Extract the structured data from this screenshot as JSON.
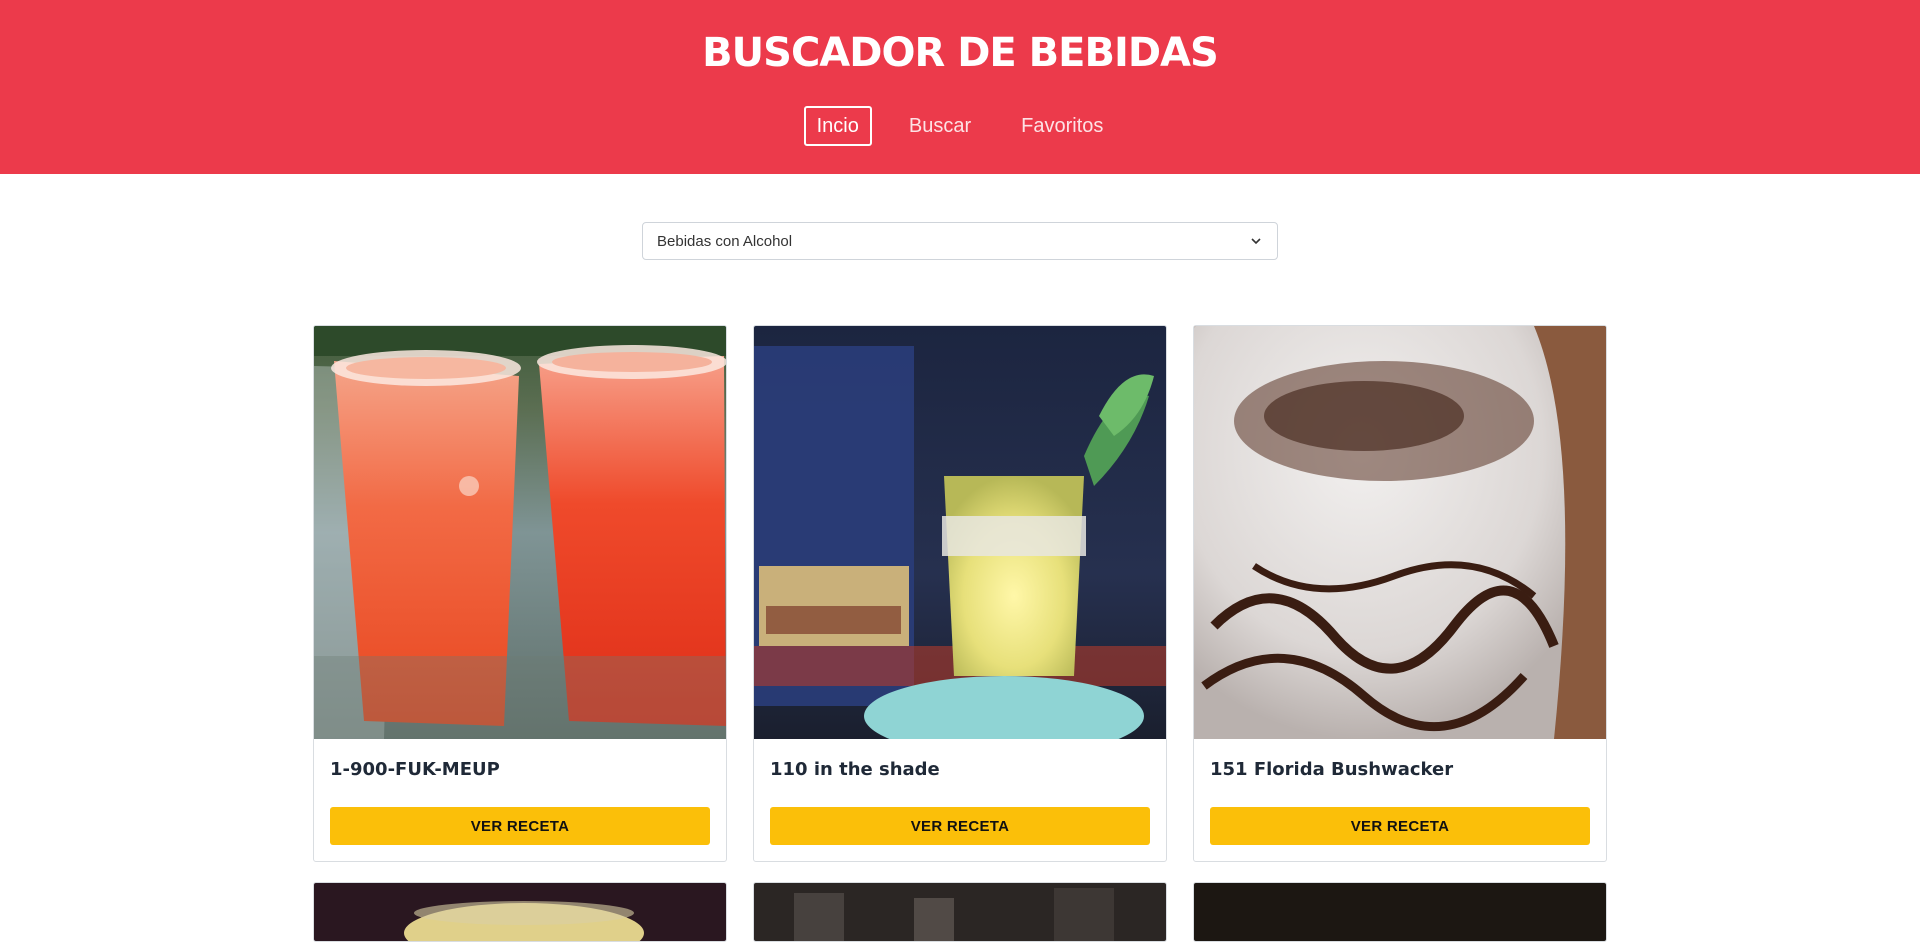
{
  "header": {
    "title": "BUSCADOR DE BEBIDAS",
    "nav": [
      {
        "label": "Incio",
        "active": true
      },
      {
        "label": "Buscar",
        "active": false
      },
      {
        "label": "Favoritos",
        "active": false
      }
    ]
  },
  "filter": {
    "selected": "Bebidas con Alcohol",
    "icon": "chevron-down-icon"
  },
  "drinks": [
    {
      "name": "1-900-FUK-MEUP",
      "button": "VER RECETA"
    },
    {
      "name": "110 in the shade",
      "button": "VER RECETA"
    },
    {
      "name": "151 Florida Bushwacker",
      "button": "VER RECETA"
    }
  ],
  "colors": {
    "header_bg": "#ec3a4b",
    "button_bg": "#fbbf09"
  }
}
